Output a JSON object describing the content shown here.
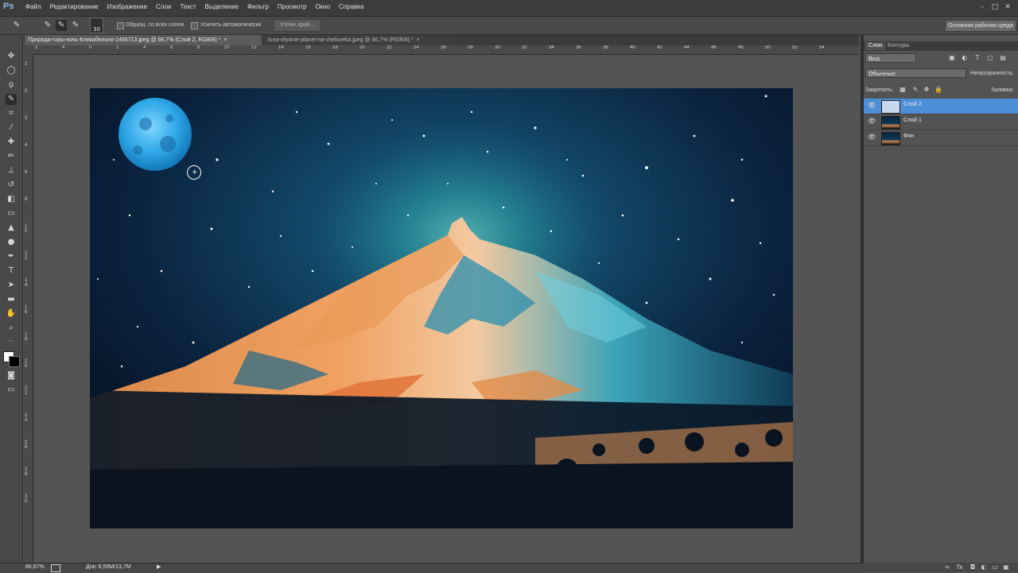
{
  "app": {
    "logo": "Ps"
  },
  "menu": [
    "Файл",
    "Редактирование",
    "Изображение",
    "Слои",
    "Текст",
    "Выделение",
    "Фильтр",
    "Просмотр",
    "Окно",
    "Справка"
  ],
  "window_controls": {
    "minimize": "–",
    "maximize": "□",
    "close": "✕"
  },
  "options_bar": {
    "brush_size": "30",
    "sample_all_layers_label": "Образц. со всех слоев",
    "auto_enhance_label": "Усилить автоматически",
    "refine_edge_label": "Уточн. край...",
    "workspace_label": "Основная рабочая среда"
  },
  "tabs": [
    {
      "label": "Природа-горы-ночь-Кликабельно-1495713.jpeg @ 66,7% (Слой 2, RGB/8) *",
      "close": "×"
    },
    {
      "label": "luna-vliyanie-planet-na-cheloveka.jpeg @ 66,7% (RGB/8) *",
      "close": "×"
    }
  ],
  "ruler_top": [
    "2",
    "4",
    "0",
    "2",
    "4",
    "6",
    "8",
    "10",
    "12",
    "14",
    "16",
    "18",
    "20",
    "22",
    "24",
    "26",
    "28",
    "30",
    "32",
    "34",
    "36",
    "38",
    "40",
    "42",
    "44",
    "46",
    "48",
    "50",
    "52",
    "54"
  ],
  "ruler_left": [
    "2",
    "0",
    "2",
    "4",
    "6",
    "8",
    "1 0",
    "1 2",
    "1 4",
    "1 6",
    "1 8",
    "2 0",
    "2 2",
    "2 4",
    "2 6",
    "2 8",
    "3 0"
  ],
  "panel": {
    "tabs": [
      "Слои",
      "Контуры"
    ],
    "kind_label": "Вид",
    "blend_mode": "Обычные",
    "opacity_label": "Непрозрачность:",
    "lock_label": "Закрепить:",
    "fill_label": "Заливка:",
    "layers": [
      {
        "name": "Слой 2",
        "selected": true,
        "thumb": "moon"
      },
      {
        "name": "Слой 1",
        "selected": false,
        "thumb": "mountain"
      },
      {
        "name": "Фон",
        "selected": false,
        "thumb": "mountain"
      }
    ]
  },
  "status": {
    "zoom": "66,67%",
    "doc": "Док: 6,59M/13,7M",
    "arrow": "▶"
  },
  "colors": {
    "selected_layer": "#4d8fd6",
    "moon": "#3fb2ee",
    "foreground": "#ffffff",
    "background": "#000000"
  }
}
